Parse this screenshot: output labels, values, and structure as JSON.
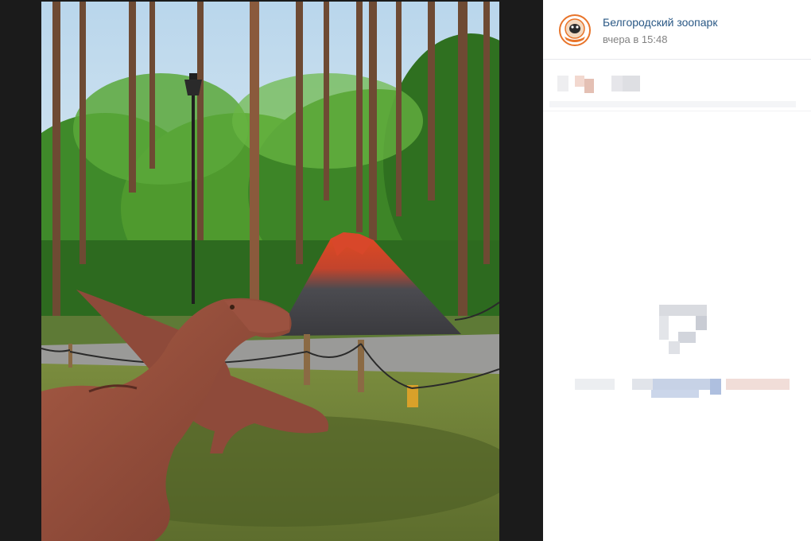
{
  "post": {
    "author_name": "Белгородский зоопарк",
    "time": "вчера в 15:48"
  },
  "icons": {
    "avatar": "zoo-logo-icon",
    "empty_comments": "comment-placeholder-icon"
  },
  "colors": {
    "author_link": "#2a5885",
    "timestamp": "#828282",
    "logo_orange": "#e8742a",
    "viewer_background": "#1b1b1b"
  }
}
